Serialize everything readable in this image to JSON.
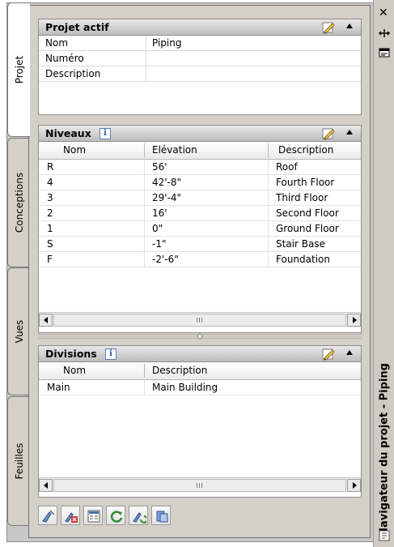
{
  "palette": {
    "title": "Navigateur du projet - Piping",
    "tabs": [
      "Projet",
      "Conceptions",
      "Vues",
      "Feuilles"
    ],
    "active_tab": "Projet"
  },
  "projet_actif": {
    "title": "Projet actif",
    "rows": [
      {
        "key": "Nom",
        "value": "Piping"
      },
      {
        "key": "Numéro",
        "value": ""
      },
      {
        "key": "Description",
        "value": ""
      }
    ]
  },
  "niveaux": {
    "title": "Niveaux",
    "columns": [
      "Nom",
      "Elévation",
      "Description"
    ],
    "rows": [
      {
        "nom": "R",
        "elevation": "56'",
        "description": "Roof"
      },
      {
        "nom": "4",
        "elevation": "42'-8\"",
        "description": "Fourth Floor"
      },
      {
        "nom": "3",
        "elevation": "29'-4\"",
        "description": "Third Floor"
      },
      {
        "nom": "2",
        "elevation": "16'",
        "description": "Second Floor"
      },
      {
        "nom": "1",
        "elevation": "0\"",
        "description": "Ground Floor"
      },
      {
        "nom": "S",
        "elevation": "-1\"",
        "description": "Stair Base"
      },
      {
        "nom": "F",
        "elevation": "-2'-6\"",
        "description": "Foundation"
      }
    ]
  },
  "divisions": {
    "title": "Divisions",
    "columns": [
      "Nom",
      "Description"
    ],
    "rows": [
      {
        "nom": "Main",
        "description": "Main Building"
      }
    ]
  },
  "toolbar_icons": [
    "new-view-icon",
    "delete-view-icon",
    "properties-icon",
    "refresh-icon",
    "regenerate-icon",
    "sheet-set-icon"
  ],
  "icons": {
    "close": "✕",
    "info": "i"
  },
  "colors": {
    "header_bg": "#cfcfcf",
    "panel_bg": "#d4d0c8",
    "accent": "#2a5ca6"
  }
}
